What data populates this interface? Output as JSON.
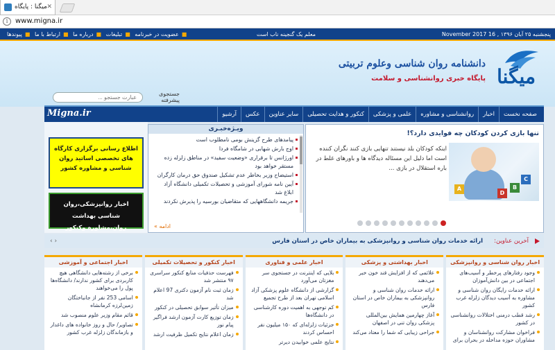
{
  "browser": {
    "tab_title": "میگنا : پایگاه خبری",
    "url": "www.migna.ir"
  },
  "topbar": {
    "date": "پنجشنبه ۲۵ آبان ۱۳۹۶ , 16 November 2017",
    "notice": "معلم یک گنجینه ناب است",
    "links": [
      "پیوندها",
      "ارتباط با ما",
      "درباره ما",
      "تبلیغات",
      "عضویت در خبرنامه"
    ]
  },
  "header": {
    "logo_name": "میگنا",
    "line1": "دانشنامه روان شناسی وعلوم تربیتی",
    "line2": "پایگاه خبری روانشناسی و سلامت"
  },
  "search": {
    "placeholder": "عبارت جستجو ...",
    "label": "جستجوی پیشرفته"
  },
  "nav": {
    "brand": "Migna.ir",
    "items": [
      "صفحه نخست",
      "اخبار",
      "روانشناسی و مشاوره",
      "علمی و پزشکی",
      "کنکور و هدایت تحصیلی",
      "سایر عناوین",
      "عکس",
      "آرشیو"
    ]
  },
  "banners": {
    "yellow": "اطلاع رسانی برگزاری کارگاه های تخصصی اساتید روان شناسی و مشاوره کشور",
    "black": "اخبار روانپزشکی،روان شناسی بهداشت روان،مشاوره وکنکور"
  },
  "features": {
    "title": "ویـژه‌خبـری",
    "items": [
      "پیامدهای طرح گزینش بومی نامطلوب است",
      "اوج بارش شهابی در شامگاه فردا",
      "اورژانس تا برقراری «وضعیت سفید» در مناطق زلزله زده مستقر خواهد بود",
      "استیضاح وزیر بخاطر عدم تشکیل صندوق حق درمان کارگران",
      "آیین نامه شورای آموزشی و تحصیلات تکمیلی دانشگاه آزاد ابلاغ شد",
      "جریمه دانشگاههایی که متقاضیان بورسیه را پذیرش نکردند"
    ],
    "more": "ادامه »"
  },
  "slider": {
    "title": "تنها بازی کردن کودکان چه فوایدی دارد؟!",
    "text": "اینکه کودکان بلد نیستند تنهایی بازی کنند نگران کننده است اما دلیل این مسئاله دیدگاه ها و باورهای غلط در باره استقلال در بازی ...",
    "dot_count": 11,
    "active_dot": 11
  },
  "latest": {
    "label": "آخرین عناوین:",
    "text": "ارائه خدمات روان شناسی و روانپزشکی به بیماران خاص در استان فارس"
  },
  "columns": [
    {
      "title": "اخبار روان شناسی و روانپزشکی",
      "items": [
        "وجود رفتارهای پرخطر و آسیب‌های اجتماعی در بین دانش‌آموزان",
        "ارائه خدمات رایگان روان شناسی و مشاوره به آسیب دیدگان زلزله غرب کشور",
        "رشد قطب درمنی اختلالات روانشناسی در کشور",
        "فراخوان مشارکت روانشناسان و مشاوران حوزه مداخله در بحران برای"
      ]
    },
    {
      "title": "اخبار بهداشتی و پزشکی",
      "items": [
        "علائمی که از افزایش قند خون خبر می‌دهند",
        "ارائه خدمات روان شناسی و روانپزشکی به بیماران خاص در استان فارس",
        "آغاز چهارمین همایش بین‌المللی پزشکی روان تنی در اصفهان",
        "جراحی زیبایی که شما را معتاد می‌کند"
      ]
    },
    {
      "title": "اخبار علمی و فناوری",
      "items": [
        "بلایی که اینترنت در جستجوی سر مغزتان می‌آورد",
        "گزارشی از دانشگاه علوم پزشکی آزاد اسلامی تهران بعد از طرح تجمیع",
        "کم توجهی به اهمیت دوره کارشناسی در دانشگاه‌ها",
        "جزئیات زلزله‌ای که ۱۵۰ میلیون نفر احساس کردند",
        "نتایج علمی خوابیدن دیرتر"
      ]
    },
    {
      "title": "اخبار کنکور و تحصیلات تکمیلی",
      "items": [
        "فهرست حذفیات منابع کنکور سراسری ۹۷ منتشر شد",
        "زمان ثبت نام آزمون دکتری 97 اعلام شد",
        "میزان تأثیر سوابق تحصیلی در کنکور",
        "زمان توزیع کارت آزمون ارشد فراگیر پیام نور",
        "زمان اعلام نتایج تکمیل ظرفیت ارشد"
      ]
    },
    {
      "title": "اخبار اجتماعی و آموزشی",
      "items": [
        "برخی از رشته‌هایی دانشگاهی هیچ کاربردی برای کشور ندارند/ دانشگاه‌ها پول را می‌خواهند",
        "اسامی 253 نفر از جانباختگان زمین‌لرزه کرمانشاه",
        "قائم مقام وزیر علوم منصوب شد",
        "تصاویر/ حال و روز خانواده های داغدار و بازماندگان زلزله غرب کشور"
      ]
    }
  ],
  "colors": {
    "navy": "#11428a",
    "accent": "#f5a800",
    "red": "#c4182c"
  }
}
